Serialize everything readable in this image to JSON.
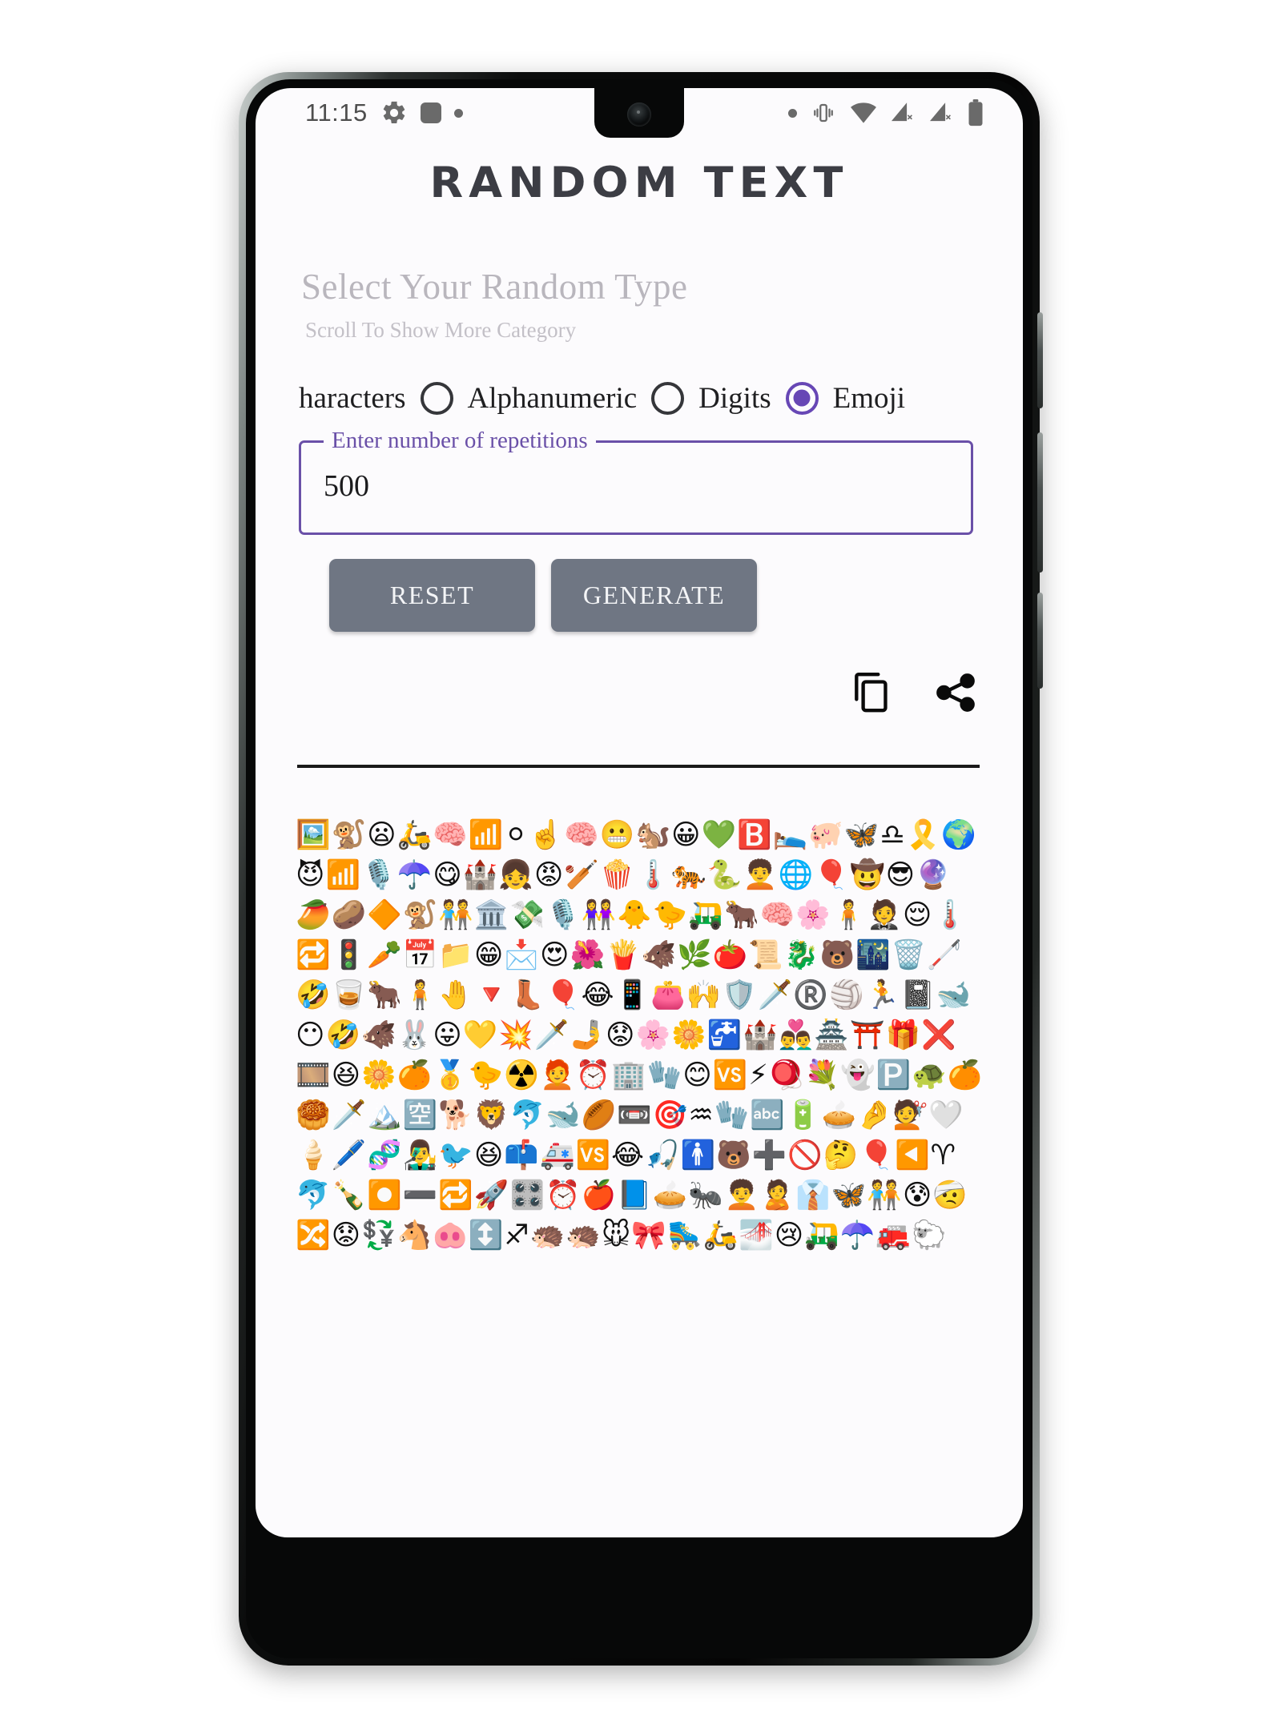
{
  "status_bar": {
    "clock": "11:15",
    "left_icons": [
      "gear-icon",
      "square-icon",
      "dot-icon"
    ],
    "right_icons": [
      "dot-icon",
      "vibrate-icon",
      "wifi-icon",
      "signal-no-sim-icon",
      "signal-no-sim-icon-2",
      "battery-icon"
    ]
  },
  "app": {
    "title": "RANDOM TEXT"
  },
  "selector": {
    "heading": "Select Your Random Type",
    "subheading": "Scroll To Show More Category",
    "options": [
      {
        "label": "haracters",
        "checked": false,
        "show_radio_before": false
      },
      {
        "label": "Alphanumeric",
        "checked": false,
        "show_radio_before": true
      },
      {
        "label": "Digits",
        "checked": false,
        "show_radio_before": true
      },
      {
        "label": "Emoji",
        "checked": true,
        "show_radio_before": true
      }
    ]
  },
  "repetitions": {
    "label": "Enter number of repetitions",
    "value": "500",
    "placeholder": "Enter number of repetitions"
  },
  "buttons": {
    "reset_label": "RESET",
    "generate_label": "GENERATE"
  },
  "result_actions": {
    "copy_icon": "copy-icon",
    "share_icon": "share-icon"
  },
  "result": {
    "text": "🖼️🐒😦🛵🧠📶⚪☝️🧠😬🐿️😀💚🅱️🛌🐖🦋♎🎗️🌍😈📶🎙️☂️😋🏰👧😡🏏🍿🌡️🐅🐍🧑‍🦱🌐🎈🤠😎🔮🥭🥔🔶🐒🧑‍🤝‍🧑🏛️💸🎙️👭🐥🐤🛺🐂🧠🌸🧍🤵😌🌡️🔁🚦🥕📅📁😁📩😍🌺🍟🐗🌿🍅📜🐉🐻🌃🗑️🦯🤣🥃🐂🧍🤚🔻👢🎈😂📱👛🙌🛡️🗡️®️🏐🏃📓🐋😶🤣🐗🐰😛💛💥🗡️🤳😟🌸🌼🚰🏰👨‍❤️‍👨🏯⛩️🎁❌🎞️😆🌼🍊🥇🐤☢️🧑‍🦰⏰🏢🧤😊🆚⚡🪀💐👻🅿️🐢🍊🥮🗡️🏔️🈳🐕🦁🐬🐋🏉📼🎯♒🧤🔤🔋🥧🤌💇🤍🍦🖊️🧬👨‍🎤🐦😆📫🚑🆚😂🎣🚹🐻➕🚫🤔🎈◀️♈🐬🍾⏺️➖🔁🚀🎛️⏰🍎📘🥧🐜🧑‍🦱🙎👔🦋🧑‍🤝‍🧑😰🤕🔀😟💱🐴🐽↕️♐🦔🦔🐭🎀🛼🛵🌁😢🛺☂️🚒🐑"
  }
}
